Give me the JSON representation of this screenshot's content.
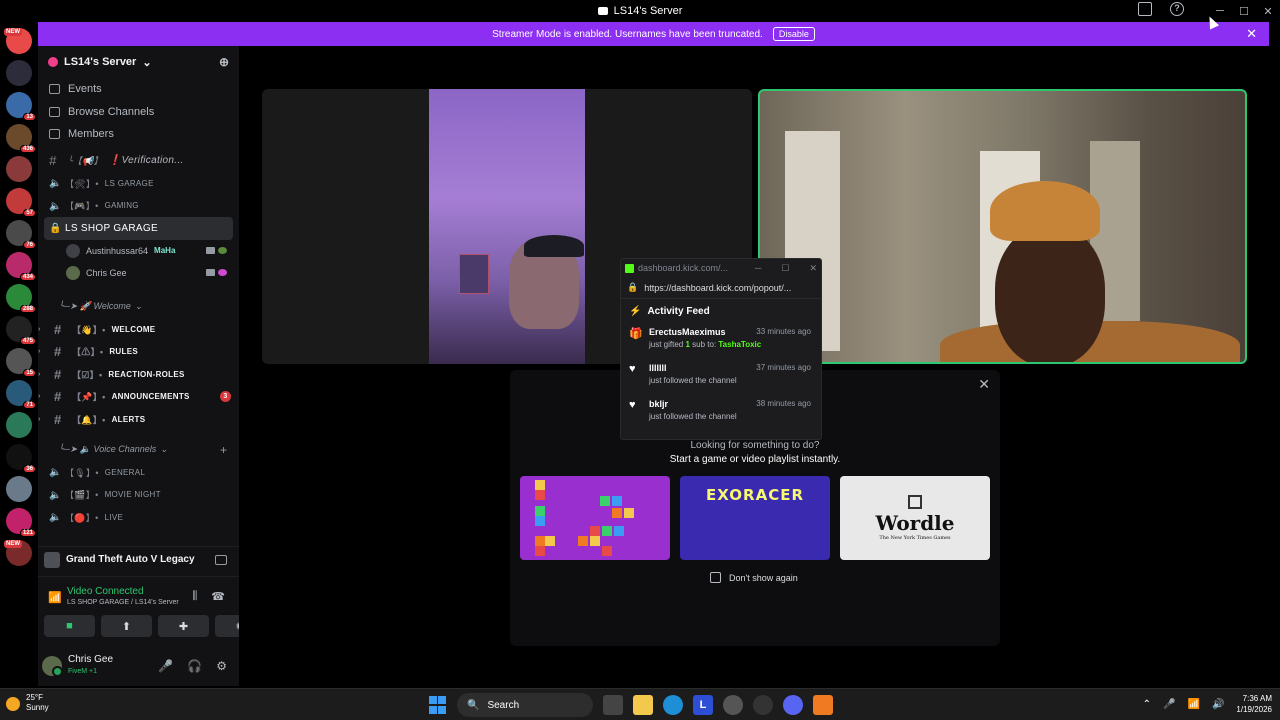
{
  "window": {
    "title": "LS14's Server"
  },
  "banner": {
    "text": "Streamer Mode is enabled. Usernames have been truncated.",
    "disable_label": "Disable"
  },
  "server_badges": [
    {
      "badge": "NEW",
      "color": "#e84a4a"
    },
    {
      "badge": "",
      "color": "#2c2c3a"
    },
    {
      "badge": "13",
      "color": "#3a6aa8"
    },
    {
      "badge": "436",
      "color": "#6a4a2a"
    },
    {
      "badge": "",
      "color": "#8a3a3a"
    },
    {
      "badge": "57",
      "color": "#c23a3a"
    },
    {
      "badge": "76",
      "color": "#4a4a4a"
    },
    {
      "badge": "434",
      "color": "#b82a6a"
    },
    {
      "badge": "288",
      "color": "#2a8a3a"
    },
    {
      "badge": "475",
      "color": "#222"
    },
    {
      "badge": "15",
      "color": "#555"
    },
    {
      "badge": "71",
      "color": "#2a5a7a"
    },
    {
      "badge": "",
      "color": "#2a7a5a"
    },
    {
      "badge": "36",
      "color": "#111"
    },
    {
      "badge": "",
      "color": "#6a7a8a"
    },
    {
      "badge": "121",
      "color": "#c2226a"
    },
    {
      "badge": "NEW",
      "color": "#7a2a2a"
    }
  ],
  "sidebar": {
    "server_name": "LS14's Server",
    "nav": [
      {
        "label": "Events"
      },
      {
        "label": "Browse Channels"
      },
      {
        "label": "Members"
      }
    ],
    "channels": [
      {
        "deco": "╰【📢】",
        "label": "❗Verification...",
        "type": "text",
        "style": "italic"
      },
      {
        "deco": "【🛠】•",
        "label": "LS GARAGE",
        "type": "voice"
      },
      {
        "deco": "【🎮】•",
        "label": "GAMING",
        "type": "voice"
      },
      {
        "label": "LS SHOP GARAGE",
        "type": "active"
      }
    ],
    "members": [
      {
        "name": "Austinhussar64",
        "tag": "MaHa"
      },
      {
        "name": "Chris Gee",
        "tag": ""
      }
    ],
    "category_welcome": "╰─➤ 🚀 Welcome",
    "welcome_channels": [
      {
        "deco": "【👋】•",
        "label": "WELCOME"
      },
      {
        "deco": "【⚠】•",
        "label": "RULES"
      },
      {
        "deco": "【☑】•",
        "label": "REACTION-ROLES"
      },
      {
        "deco": "【📌】•",
        "label": "ANNOUNCEMENTS",
        "mention": "3"
      },
      {
        "deco": "【🔔】•",
        "label": "ALERTS"
      }
    ],
    "category_voice": "╰─➤ 🔈 Voice Channels",
    "voice_channels": [
      {
        "deco": "【🎙】•",
        "label": "GENERAL"
      },
      {
        "deco": "【🎬】•",
        "label": "MOVIE NIGHT"
      },
      {
        "deco": "【🔴】•",
        "label": "LIVE"
      }
    ],
    "game": "Grand Theft Auto V Legacy",
    "voice_connection": {
      "status": "Video Connected",
      "location": "LS SHOP GARAGE / LS14's Server"
    },
    "user": {
      "name": "Chris Gee",
      "status": "FiveM +1"
    }
  },
  "activity_feed": {
    "tab_title": "dashboard.kick.com/...",
    "url": "https://dashboard.kick.com/popout/...",
    "heading": "Activity Feed",
    "items": [
      {
        "name": "ErectusMaeximus",
        "time": "33 minutes ago",
        "desc_pre": "just gifted ",
        "desc_num": "1",
        "desc_mid": " sub to: ",
        "desc_target": "TashaToxic",
        "icon": "gift"
      },
      {
        "name": "lllllll",
        "time": "37 minutes ago",
        "desc": "just followed the channel",
        "icon": "heart"
      },
      {
        "name": "bkljr",
        "time": "38 minutes ago",
        "desc": "just followed the channel",
        "icon": "heart"
      }
    ]
  },
  "activities_panel": {
    "question": "Looking for something to do?",
    "subtitle": "Start a game or video playlist instantly.",
    "cards": [
      {
        "label": ""
      },
      {
        "label": "EXORACER"
      },
      {
        "label": "Wordle",
        "sub": "The New York Times Games"
      }
    ],
    "dont_show": "Don't show again"
  },
  "taskbar": {
    "weather_temp": "25°F",
    "weather_desc": "Sunny",
    "search_label": "Search",
    "time": "7:36 AM",
    "date": "1/19/2026"
  }
}
